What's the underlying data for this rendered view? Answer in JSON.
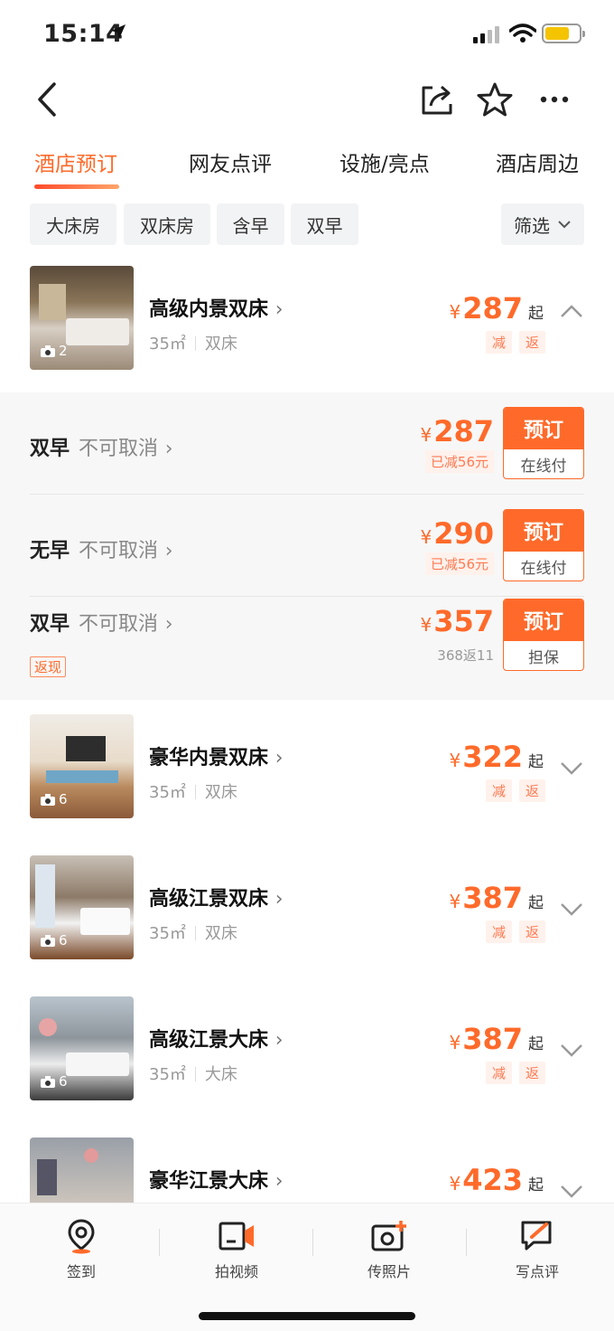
{
  "status": {
    "time": "15:14"
  },
  "tabs": [
    {
      "label": "酒店预订",
      "active": true
    },
    {
      "label": "网友点评"
    },
    {
      "label": "设施/亮点"
    },
    {
      "label": "酒店周边"
    }
  ],
  "filters": [
    "大床房",
    "双床房",
    "含早",
    "双早"
  ],
  "filter_button": "筛选",
  "rooms": [
    {
      "name": "高级内景双床",
      "area": "35㎡",
      "bed": "双床",
      "currency": "¥",
      "price": "287",
      "from": "起",
      "tags": [
        "减",
        "返"
      ],
      "photos": "2",
      "expanded": true
    },
    {
      "name": "豪华内景双床",
      "area": "35㎡",
      "bed": "双床",
      "currency": "¥",
      "price": "322",
      "from": "起",
      "tags": [
        "减",
        "返"
      ],
      "photos": "6"
    },
    {
      "name": "高级江景双床",
      "area": "35㎡",
      "bed": "双床",
      "currency": "¥",
      "price": "387",
      "from": "起",
      "tags": [
        "减",
        "返"
      ],
      "photos": "6"
    },
    {
      "name": "高级江景大床",
      "area": "35㎡",
      "bed": "大床",
      "currency": "¥",
      "price": "387",
      "from": "起",
      "tags": [
        "减",
        "返"
      ],
      "photos": "6"
    },
    {
      "name": "豪华江景大床",
      "currency": "¥",
      "price": "423",
      "from": "起"
    }
  ],
  "rates": [
    {
      "plan": "双早",
      "cancel": "不可取消",
      "currency": "¥",
      "price": "287",
      "note": "已减56元",
      "book": "预订",
      "pay": "在线付"
    },
    {
      "plan": "无早",
      "cancel": "不可取消",
      "currency": "¥",
      "price": "290",
      "note": "已减56元",
      "book": "预订",
      "pay": "在线付"
    },
    {
      "plan": "双早",
      "cancel": "不可取消",
      "currency": "¥",
      "price": "357",
      "note": "368返11",
      "tag": "返现",
      "book": "预订",
      "pay": "担保"
    }
  ],
  "bottom_bar": [
    {
      "label": "签到",
      "icon": "location-pin-icon"
    },
    {
      "label": "拍视频",
      "icon": "video-camera-icon"
    },
    {
      "label": "传照片",
      "icon": "add-photo-icon"
    },
    {
      "label": "写点评",
      "icon": "write-review-icon"
    }
  ],
  "colors": {
    "accent": "#ff6a2a",
    "tag_bg": "#fff1ec",
    "panel_bg": "#f7f7f7"
  }
}
